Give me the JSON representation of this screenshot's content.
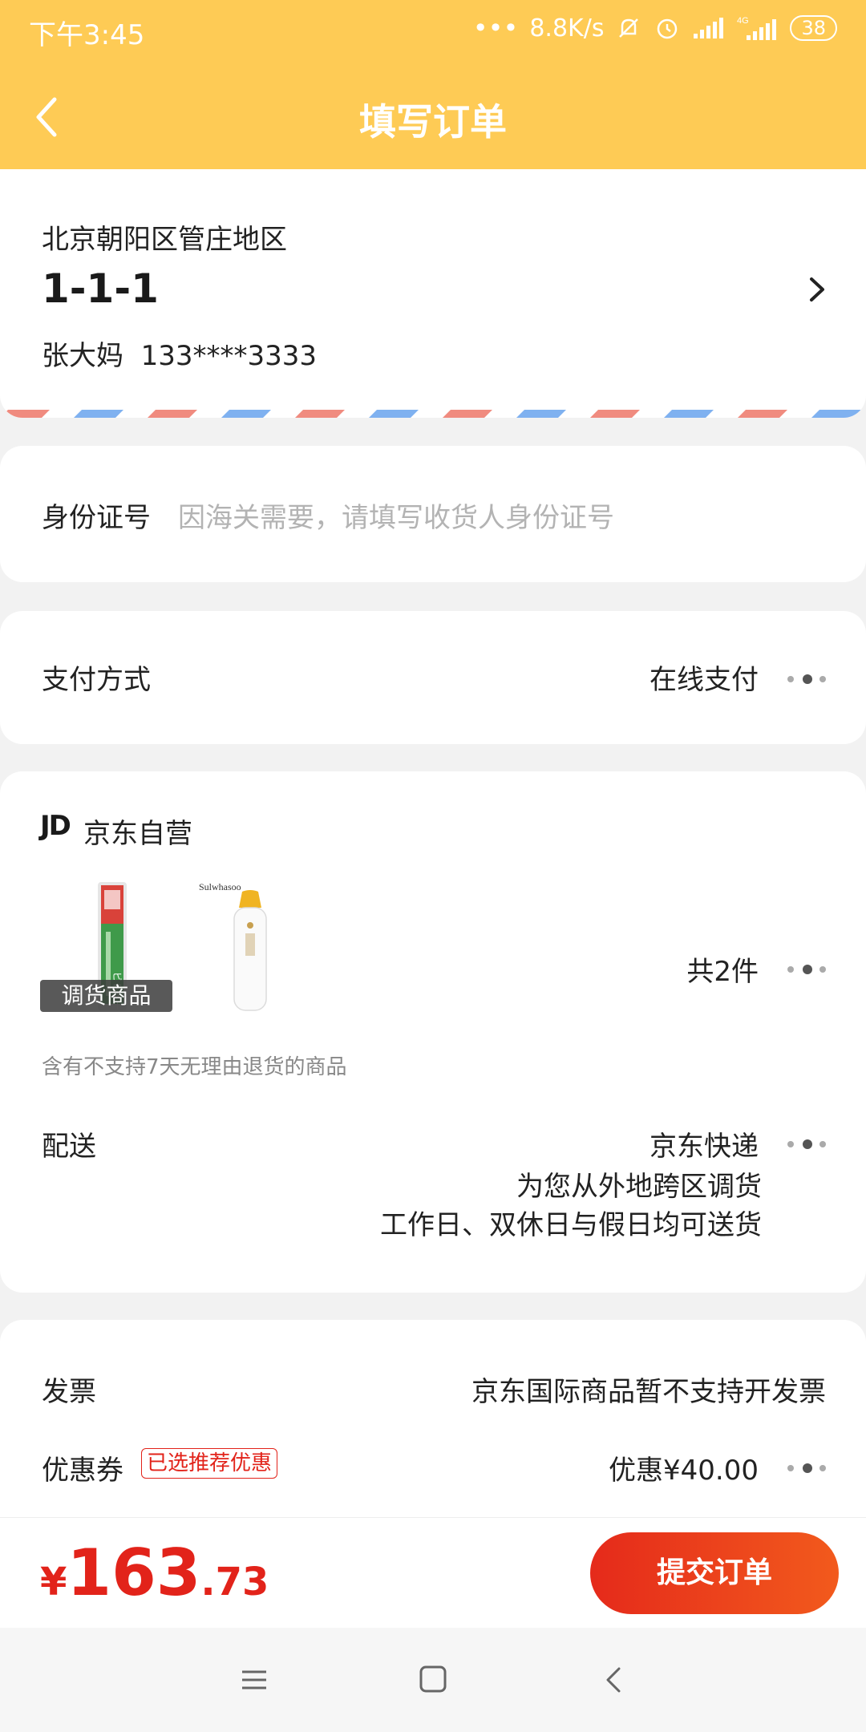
{
  "status_bar": {
    "time": "下午3:45",
    "net_speed": "8.8K/s",
    "battery": "38",
    "signal_type": "4G"
  },
  "nav": {
    "title": "填写订单"
  },
  "address": {
    "region": "北京朝阳区管庄地区",
    "detail": "1-1-1",
    "name": "张大妈",
    "phone": "133****3333"
  },
  "id_field": {
    "label": "身份证号",
    "placeholder": "因海关需要，请填写收货人身份证号"
  },
  "payment": {
    "label": "支付方式",
    "value": "在线支付"
  },
  "shop": {
    "logo": "JD",
    "name": "京东自营",
    "transfer_tag": "调货商品",
    "count": "共2件",
    "notice": "含有不支持7天无理由退货的商品",
    "products": [
      {
        "name": "toothbrush-product-image",
        "brand": "ビトイーン"
      },
      {
        "name": "sulwhasoo-product-image",
        "brand": "Sulwhasoo"
      }
    ]
  },
  "delivery": {
    "label": "配送",
    "carrier": "京东快递",
    "line2": "为您从外地跨区调货",
    "line3": "工作日、双休日与假日均可送货"
  },
  "invoice": {
    "label": "发票",
    "value": "京东国际商品暂不支持开发票"
  },
  "coupon": {
    "label": "优惠券",
    "badge": "已选推荐优惠",
    "value": "优惠¥40.00"
  },
  "total": {
    "symbol": "¥",
    "integer": "163",
    "decimal": ".73"
  },
  "submit_label": "提交订单",
  "colors": {
    "header": "#fecb55",
    "accent": "#e2231a"
  }
}
